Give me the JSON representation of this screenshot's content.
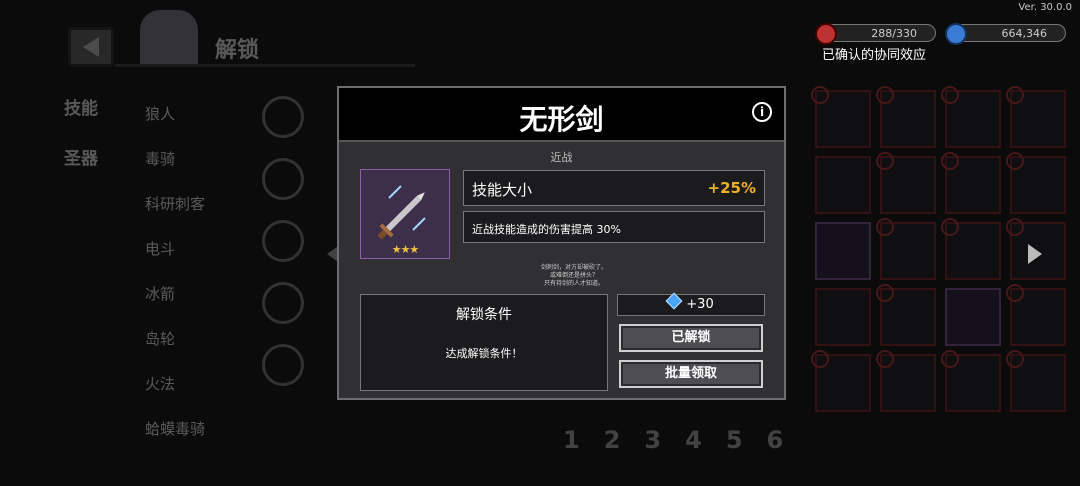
{
  "version": "Ver. 30.0.0",
  "header": {
    "title": "解锁"
  },
  "side_tabs": [
    "技能",
    "圣器"
  ],
  "list_items": [
    "狼人",
    "毒骑",
    "科研刺客",
    "电斗",
    "冰箭",
    "岛轮",
    "火法",
    "蛤蟆毒骑"
  ],
  "topbar": {
    "stamina": "288/330",
    "gems": "664,346",
    "synergy": "已确认的协同效应"
  },
  "pages": [
    "1",
    "2",
    "3",
    "4",
    "5",
    "6"
  ],
  "dialog": {
    "title": "无形剑",
    "category": "近战",
    "stars": "★★★",
    "stat": {
      "name": "技能大小",
      "value": "+25%"
    },
    "description": "近战技能造成的伤害提高 30%",
    "flavor": "剑刺剑，对方却被砍了。\n或难倒还是拼头？\n只有持剑的人才知道。",
    "condition": {
      "title": "解锁条件",
      "text": "达成解锁条件！"
    },
    "reward": "+30",
    "btn_unlocked": "已解锁",
    "btn_batch": "批量领取"
  },
  "colors": {
    "accent_gold": "#f0b020",
    "item_purple": "#8c5fa8"
  }
}
